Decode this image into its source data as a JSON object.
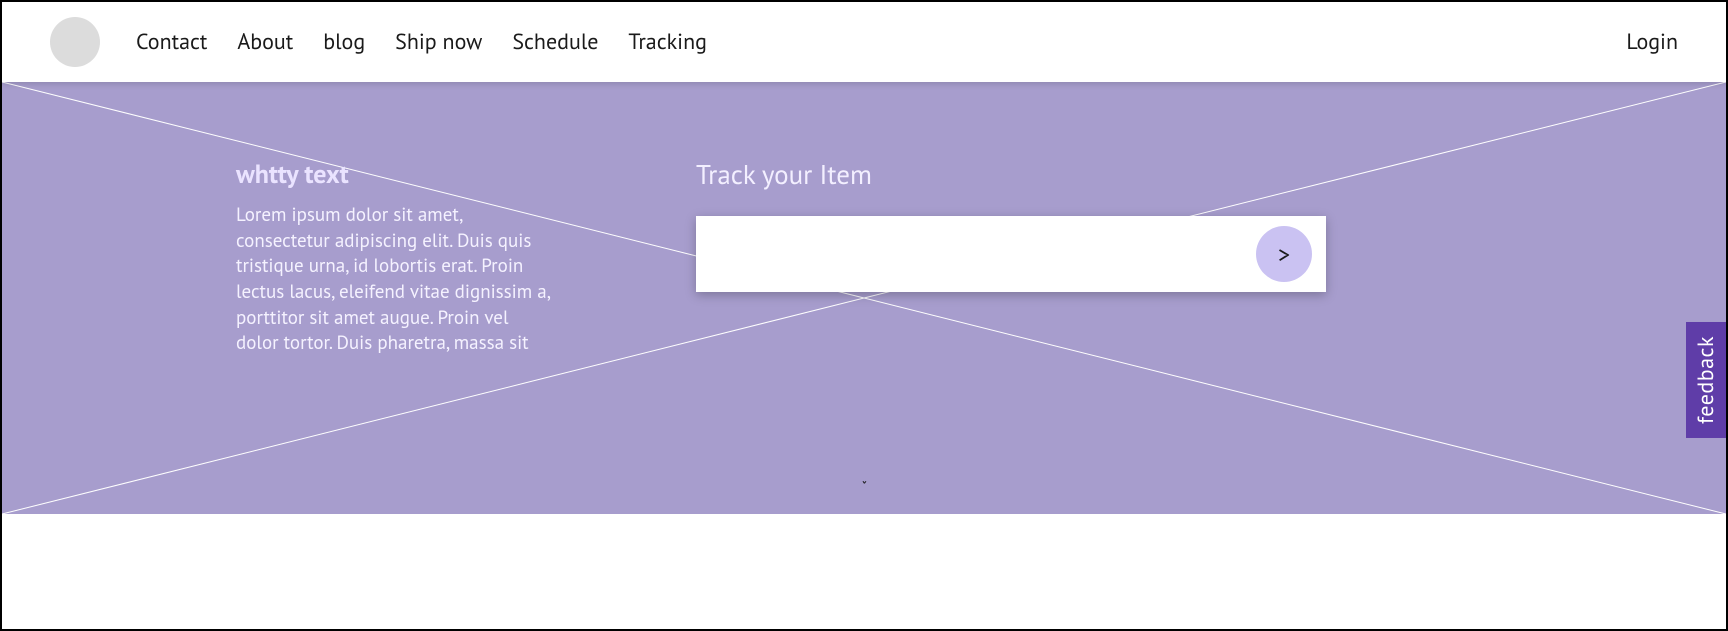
{
  "nav": {
    "items": [
      {
        "label": "Contact"
      },
      {
        "label": "About"
      },
      {
        "label": "blog"
      },
      {
        "label": "Ship now"
      },
      {
        "label": "Schedule"
      },
      {
        "label": "Tracking"
      }
    ],
    "login": "Login"
  },
  "hero": {
    "heading": "whtty text",
    "body": "Lorem ipsum dolor sit amet, consectetur adipiscing elit. Duis quis tristique urna, id lobortis erat. Proin lectus lacus, eleifend vitae dignissim a, porttitor sit amet augue. Proin vel dolor tortor. Duis pharetra, massa sit",
    "track_title": "Track your Item",
    "track_placeholder": "",
    "track_button": ">",
    "down_arrow": "ˇ"
  },
  "feedback": {
    "label": "feedback"
  },
  "colors": {
    "hero_bg": "#a79dcd",
    "feedback_bg": "#5f3da8",
    "track_btn_bg": "#cac2f2"
  }
}
